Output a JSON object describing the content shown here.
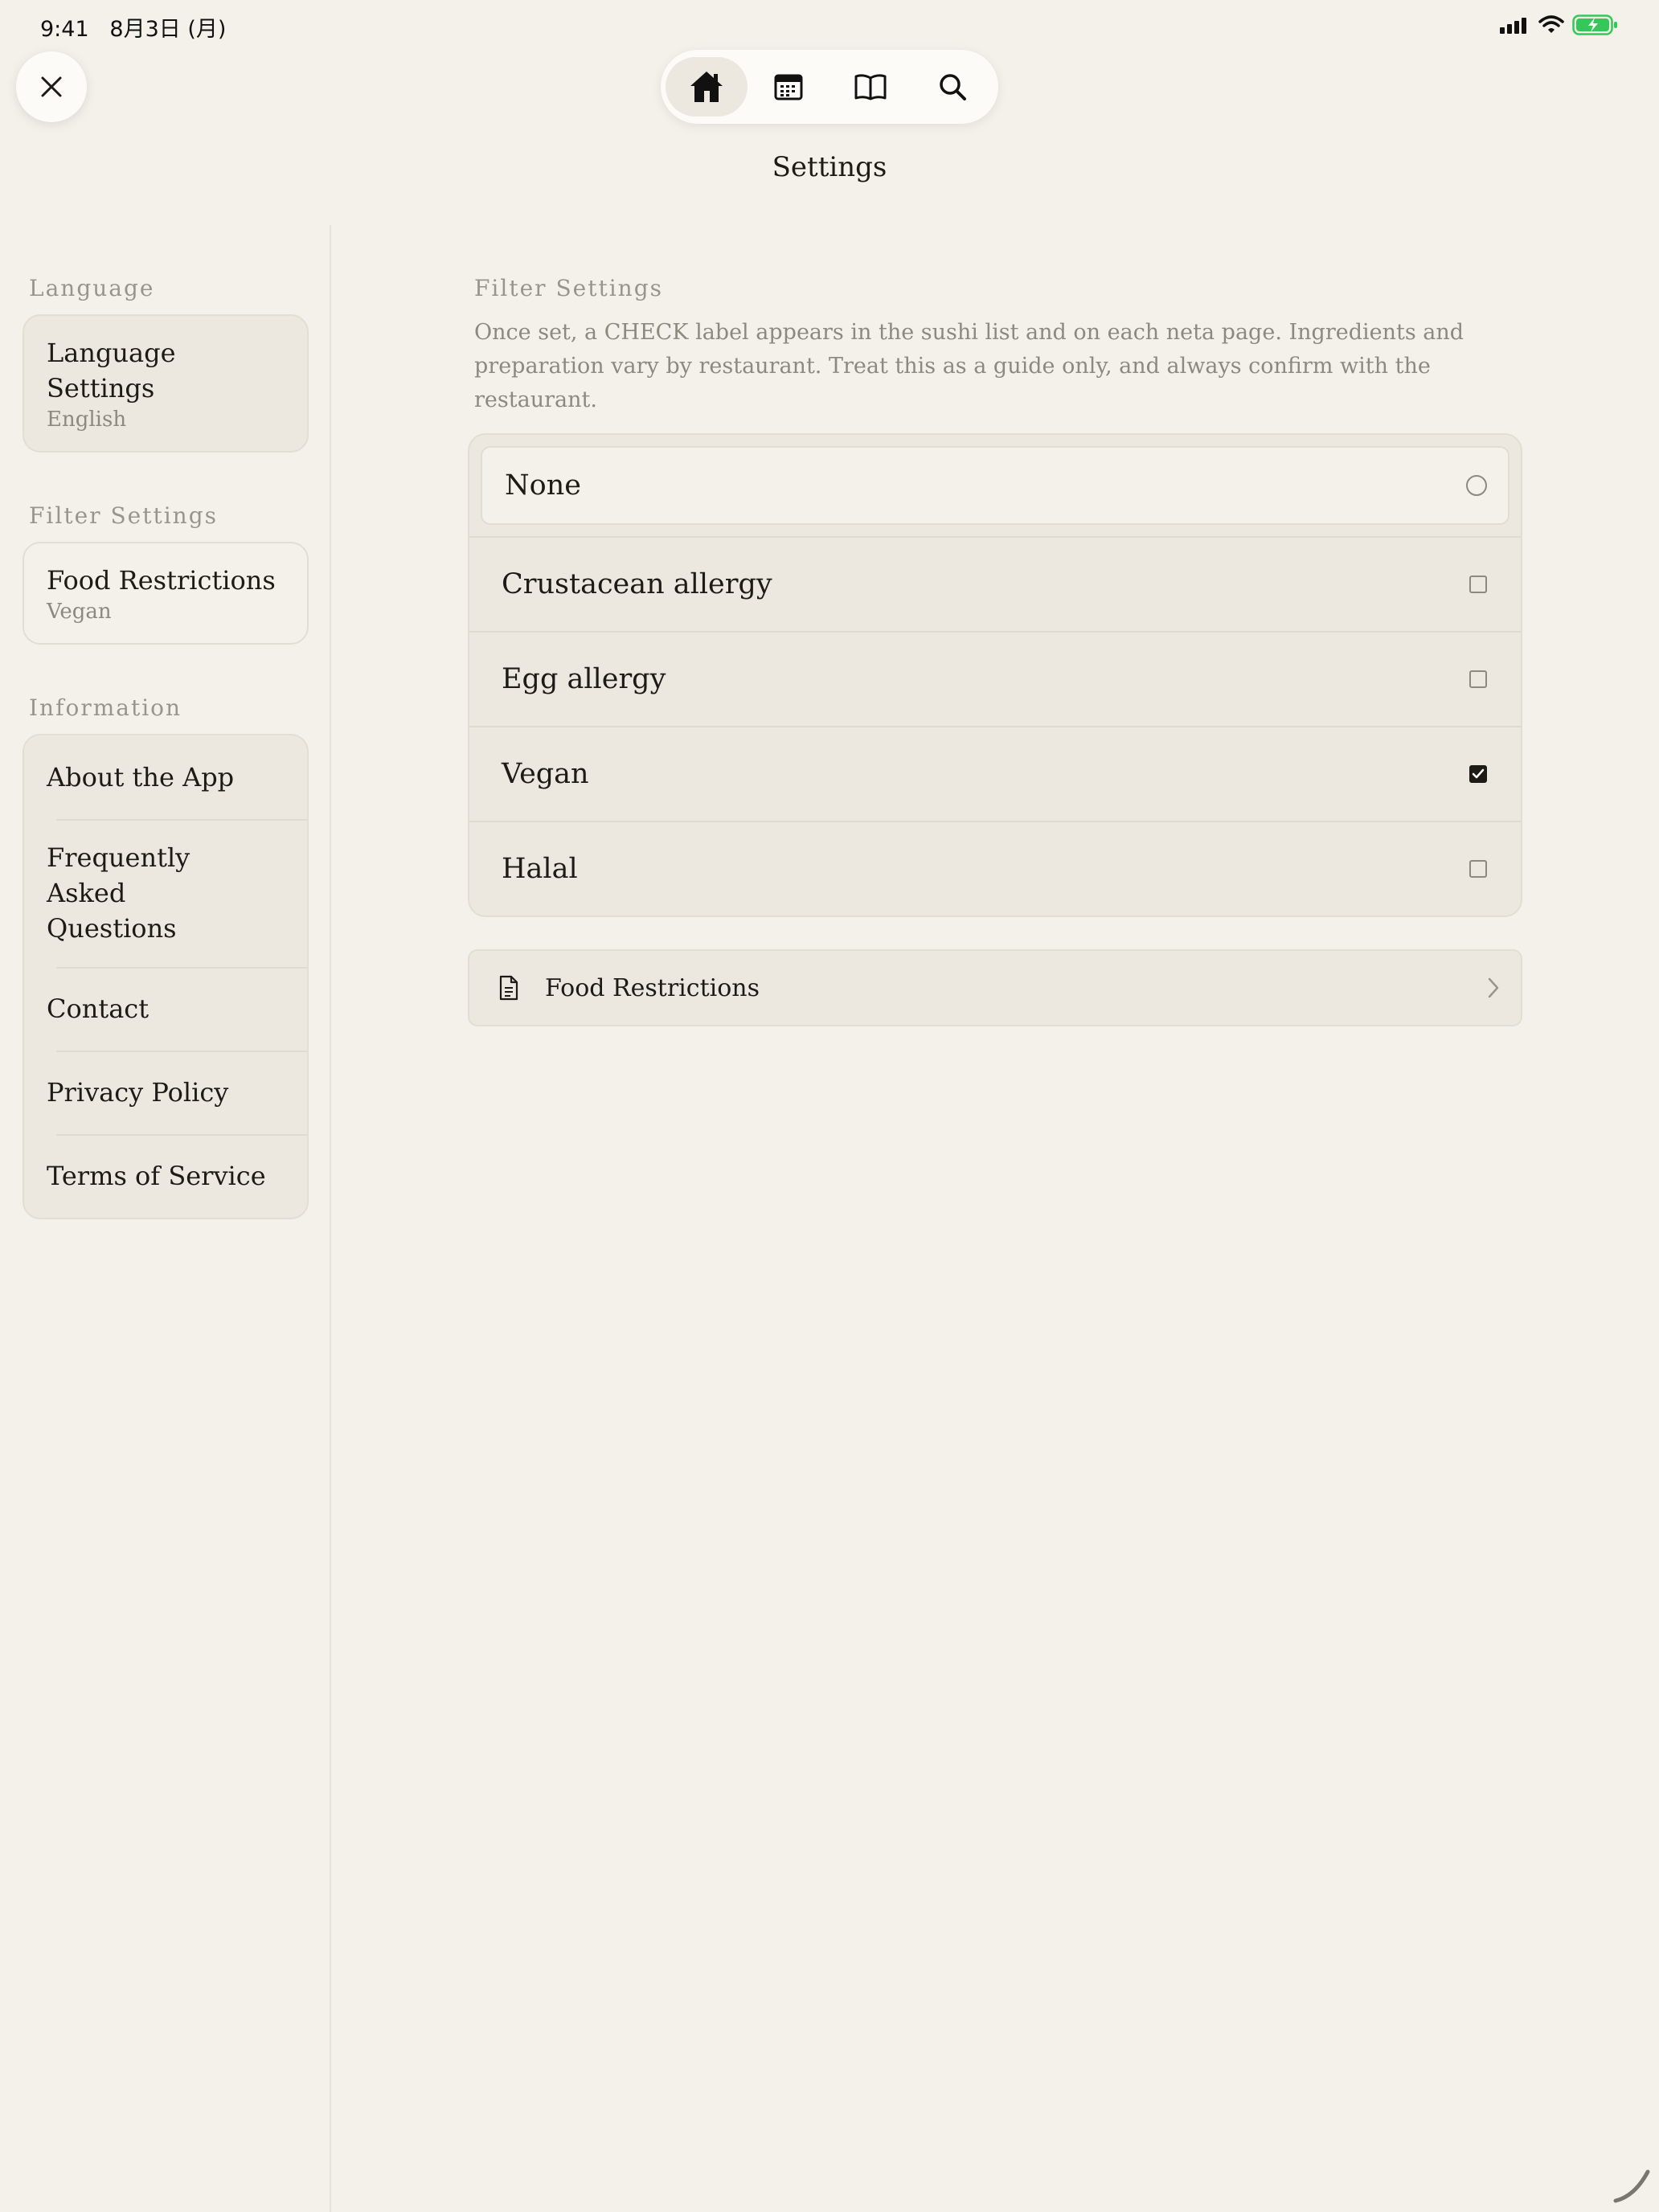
{
  "status_bar": {
    "time": "9:41",
    "date": "8月3日 (月)"
  },
  "nav": {
    "items": [
      {
        "icon": "home-icon",
        "active": true
      },
      {
        "icon": "calendar-icon",
        "active": false
      },
      {
        "icon": "book-icon",
        "active": false
      },
      {
        "icon": "search-icon",
        "active": false
      }
    ]
  },
  "title": "Settings",
  "sidebar": {
    "language": {
      "heading": "Language",
      "item": {
        "label": "Language Settings",
        "value": "English"
      }
    },
    "filter": {
      "heading": "Filter Settings",
      "item": {
        "label": "Food Restrictions",
        "value": "Vegan"
      }
    },
    "information": {
      "heading": "Information",
      "items": [
        {
          "label": "About the App"
        },
        {
          "label": "Frequently Asked Questions"
        },
        {
          "label": "Contact"
        },
        {
          "label": "Privacy Policy"
        },
        {
          "label": "Terms of Service"
        }
      ]
    }
  },
  "main": {
    "heading": "Filter Settings",
    "description": "Once set, a CHECK label appears in the sushi list and on each neta page. Ingredients and preparation vary by restaurant. Treat this as a guide only, and always confirm with the restaurant.",
    "none_option": {
      "label": "None",
      "selected": false
    },
    "options": [
      {
        "label": "Crustacean allergy",
        "checked": false
      },
      {
        "label": "Egg allergy",
        "checked": false
      },
      {
        "label": "Vegan",
        "checked": true
      },
      {
        "label": "Halal",
        "checked": false
      }
    ],
    "link": {
      "label": "Food Restrictions",
      "icon": "document-icon"
    }
  },
  "colors": {
    "background": "#f4f1eb",
    "card": "#ece8df",
    "text": "#1e1b17",
    "muted": "#9a958c",
    "battery": "#34c759"
  }
}
